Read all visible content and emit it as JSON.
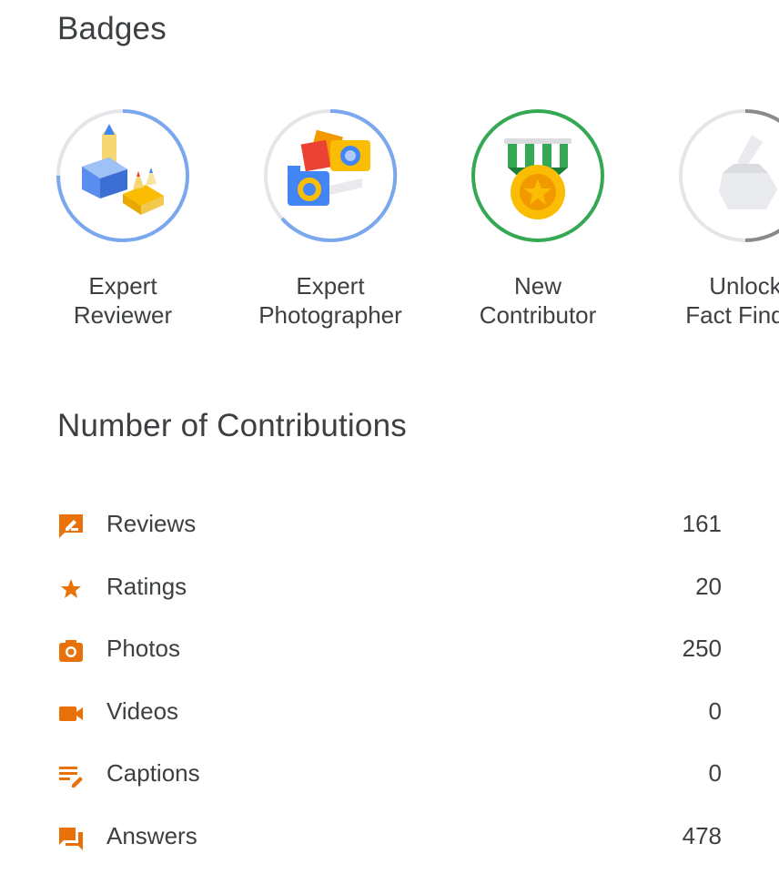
{
  "badges_section": {
    "title": "Badges",
    "badges": [
      {
        "label": "Expert\nReviewer",
        "icon": "pencils-icon",
        "ring_color": "#7aa7ee",
        "progress": 0.75
      },
      {
        "label": "Expert\nPhotographer",
        "icon": "cameras-icon",
        "ring_color": "#7aa7ee",
        "progress": 0.6
      },
      {
        "label": "New\nContributor",
        "icon": "medal-icon",
        "ring_color": "#34a853",
        "progress": 1.0
      },
      {
        "label": "Unlock\nFact Finder",
        "icon": "locked-badge-icon",
        "ring_color": "#8a8a8a",
        "progress": 0.5
      }
    ]
  },
  "contributions_section": {
    "title": "Number of Contributions",
    "accent_color": "#e8710a",
    "items": [
      {
        "label": "Reviews",
        "value": "161",
        "icon": "review-icon"
      },
      {
        "label": "Ratings",
        "value": "20",
        "icon": "star-icon"
      },
      {
        "label": "Photos",
        "value": "250",
        "icon": "camera-icon"
      },
      {
        "label": "Videos",
        "value": "0",
        "icon": "video-icon"
      },
      {
        "label": "Captions",
        "value": "0",
        "icon": "caption-icon"
      },
      {
        "label": "Answers",
        "value": "478",
        "icon": "answer-icon"
      }
    ]
  }
}
